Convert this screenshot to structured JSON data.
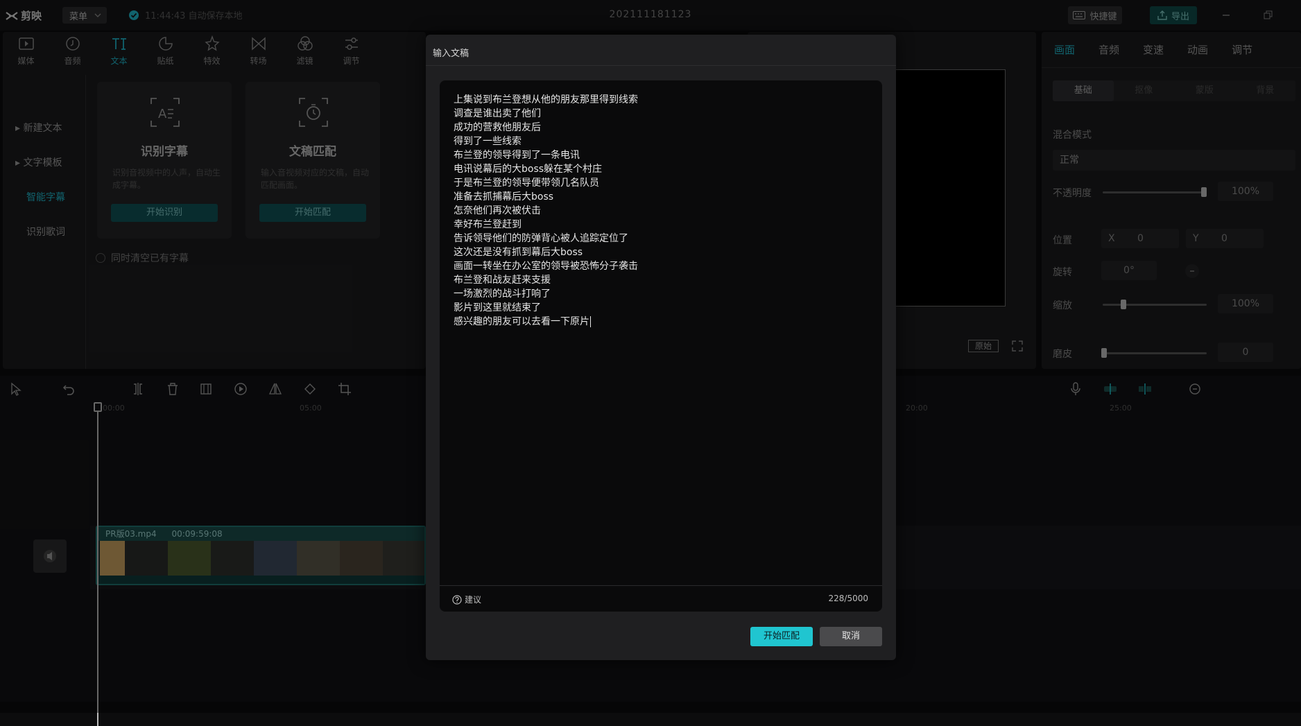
{
  "app": {
    "name": "剪映",
    "menu_label": "菜单",
    "save_status": "11:44:43 自动保存本地",
    "project_title": "202111181123",
    "shortcut_label": "快捷键",
    "export_label": "导出"
  },
  "tool_tabs": [
    {
      "label": "媒体",
      "icon": "media-icon"
    },
    {
      "label": "音频",
      "icon": "audio-icon"
    },
    {
      "label": "文本",
      "icon": "text-icon"
    },
    {
      "label": "贴纸",
      "icon": "sticker-icon"
    },
    {
      "label": "特效",
      "icon": "effects-icon"
    },
    {
      "label": "转场",
      "icon": "transition-icon"
    },
    {
      "label": "滤镜",
      "icon": "filter-icon"
    },
    {
      "label": "调节",
      "icon": "adjust-icon"
    }
  ],
  "side_nav": [
    "新建文本",
    "文字模板",
    "智能字幕",
    "识别歌词"
  ],
  "cards": [
    {
      "title": "识别字幕",
      "desc": "识别音视频中的人声，自动生成字幕。",
      "button": "开始识别"
    },
    {
      "title": "文稿匹配",
      "desc": "输入音视频对应的文稿，自动匹配画面。",
      "button": "开始匹配"
    }
  ],
  "clear_subs_label": "同时清空已有字幕",
  "player": {
    "ratio_label": "原始"
  },
  "right_panel": {
    "tabs": [
      "画面",
      "音频",
      "变速",
      "动画",
      "调节"
    ],
    "sub_tabs": [
      "基础",
      "抠像",
      "蒙版",
      "背景"
    ],
    "blend_mode_label": "混合模式",
    "blend_mode_value": "正常",
    "opacity_label": "不透明度",
    "opacity_value": "100%",
    "opacity_level": 1.0,
    "position_label": "位置",
    "pos_x_label": "X",
    "pos_x_value": "0",
    "pos_y_label": "Y",
    "pos_y_value": "0",
    "rotate_label": "旋转",
    "rotate_value": "0°",
    "scale_label": "缩放",
    "scale_value": "100%",
    "scale_level": 0.2,
    "smooth_label": "磨皮",
    "smooth_value": "0",
    "smooth_level": 0.0
  },
  "timeline": {
    "ticks": [
      "00:00",
      "05:00",
      "20:00",
      "25:00"
    ],
    "clip_name": "PR版03.mp4",
    "clip_duration": "00:09:59:08"
  },
  "modal": {
    "title": "输入文稿",
    "lines": [
      "上集说到布兰登想从他的朋友那里得到线索",
      "调查是谁出卖了他们",
      "成功的营救他朋友后",
      "得到了一些线索",
      "布兰登的领导得到了一条电讯",
      "电讯说幕后的大boss躲在某个村庄",
      "于是布兰登的领导便带领几名队员",
      "准备去抓捕幕后大boss",
      "怎奈他们再次被伏击",
      "幸好布兰登赶到",
      "告诉领导他们的防弹背心被人追踪定位了",
      "这次还是没有抓到幕后大boss",
      "画面一转坐在办公室的领导被恐怖分子袭击",
      "布兰登和战友赶来支援",
      "一场激烈的战斗打响了",
      "影片到这里就结束了",
      "感兴趣的朋友可以去看一下原片"
    ],
    "suggest_label": "建议",
    "char_count": "228/5000",
    "start_button": "开始匹配",
    "cancel_button": "取消"
  },
  "colors": {
    "accent": "#20c5d0",
    "panel": "#1b1b1d",
    "modal": "#1f1f21",
    "editor": "#0a0a0b"
  }
}
